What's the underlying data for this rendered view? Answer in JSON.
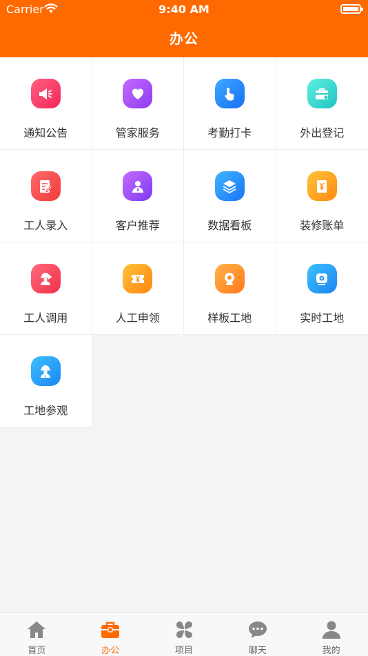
{
  "status_bar": {
    "carrier": "Carrier",
    "time": "9:40 AM"
  },
  "header": {
    "title": "办公"
  },
  "apps": [
    {
      "label": "通知公告",
      "icon": "megaphone-icon",
      "color_from": "#ff5f7e",
      "color_to": "#f2285a"
    },
    {
      "label": "管家服务",
      "icon": "heart-icon",
      "color_from": "#c36bff",
      "color_to": "#8f3cf0"
    },
    {
      "label": "考勤打卡",
      "icon": "tap-hand-icon",
      "color_from": "#3fa9ff",
      "color_to": "#1570f5"
    },
    {
      "label": "外出登记",
      "icon": "briefcase-icon",
      "color_from": "#5ef0e0",
      "color_to": "#22c3c3"
    },
    {
      "label": "工人录入",
      "icon": "edit-form-icon",
      "color_from": "#ff6a6a",
      "color_to": "#f03a3a"
    },
    {
      "label": "客户推荐",
      "icon": "customer-icon",
      "color_from": "#c36bff",
      "color_to": "#7e3cf0"
    },
    {
      "label": "数据看板",
      "icon": "layers-icon",
      "color_from": "#3fb6ff",
      "color_to": "#1a74f5"
    },
    {
      "label": "装修账单",
      "icon": "ledger-icon",
      "color_from": "#ffc23a",
      "color_to": "#ff8a12"
    },
    {
      "label": "工人调用",
      "icon": "worker-icon",
      "color_from": "#ff6a7e",
      "color_to": "#f0304a"
    },
    {
      "label": "人工申领",
      "icon": "ticket-icon",
      "color_from": "#ffc23a",
      "color_to": "#ff8512"
    },
    {
      "label": "样板工地",
      "icon": "webcam-icon",
      "color_from": "#ffb24a",
      "color_to": "#ff7a1a"
    },
    {
      "label": "实时工地",
      "icon": "camera-icon",
      "color_from": "#3fbfff",
      "color_to": "#1a86f0"
    },
    {
      "label": "工地参观",
      "icon": "engineer-icon",
      "color_from": "#3fbfff",
      "color_to": "#1a86f0"
    }
  ],
  "tabbar": [
    {
      "label": "首页",
      "icon": "home-icon",
      "active": false
    },
    {
      "label": "办公",
      "icon": "briefcase-icon",
      "active": true
    },
    {
      "label": "项目",
      "icon": "clover-icon",
      "active": false
    },
    {
      "label": "聊天",
      "icon": "chat-bubble-icon",
      "active": false
    },
    {
      "label": "我的",
      "icon": "person-icon",
      "active": false
    }
  ],
  "colors": {
    "brand": "#ff6a00",
    "tab_inactive": "#666666",
    "tab_icon_inactive": "#888888"
  }
}
